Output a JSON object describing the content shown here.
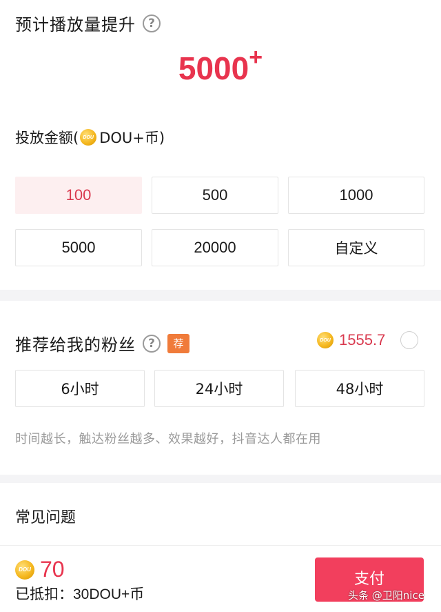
{
  "estimate": {
    "title": "预计播放量提升",
    "help_glyph": "?",
    "value": "5000",
    "value_suffix": "+"
  },
  "amount": {
    "label_prefix": "投放金额(",
    "coin_label": "DOU",
    "label_suffix": "DOU+币)",
    "options": [
      "100",
      "500",
      "1000",
      "5000",
      "20000",
      "自定义"
    ],
    "selected": "100"
  },
  "fans": {
    "title": "推荐给我的粉丝",
    "help_glyph": "?",
    "badge": "荐",
    "price": "1555.7",
    "durations": [
      "6小时",
      "24小时",
      "48小时"
    ],
    "hint": "时间越长，触达粉丝越多、效果越好，抖音达人都在用"
  },
  "faq": {
    "title": "常见问题"
  },
  "footer": {
    "total": "70",
    "deduct_label": "已抵扣：",
    "deduct_value": "30DOU+币",
    "pay_label": "支付",
    "watermark": "头条 @卫阳nice"
  },
  "colors": {
    "accent": "#e8344e",
    "selected_bg": "#fdeff0",
    "pay_button": "#f23f5d",
    "badge": "#f07b3a",
    "divider": "#f4f4f6"
  }
}
